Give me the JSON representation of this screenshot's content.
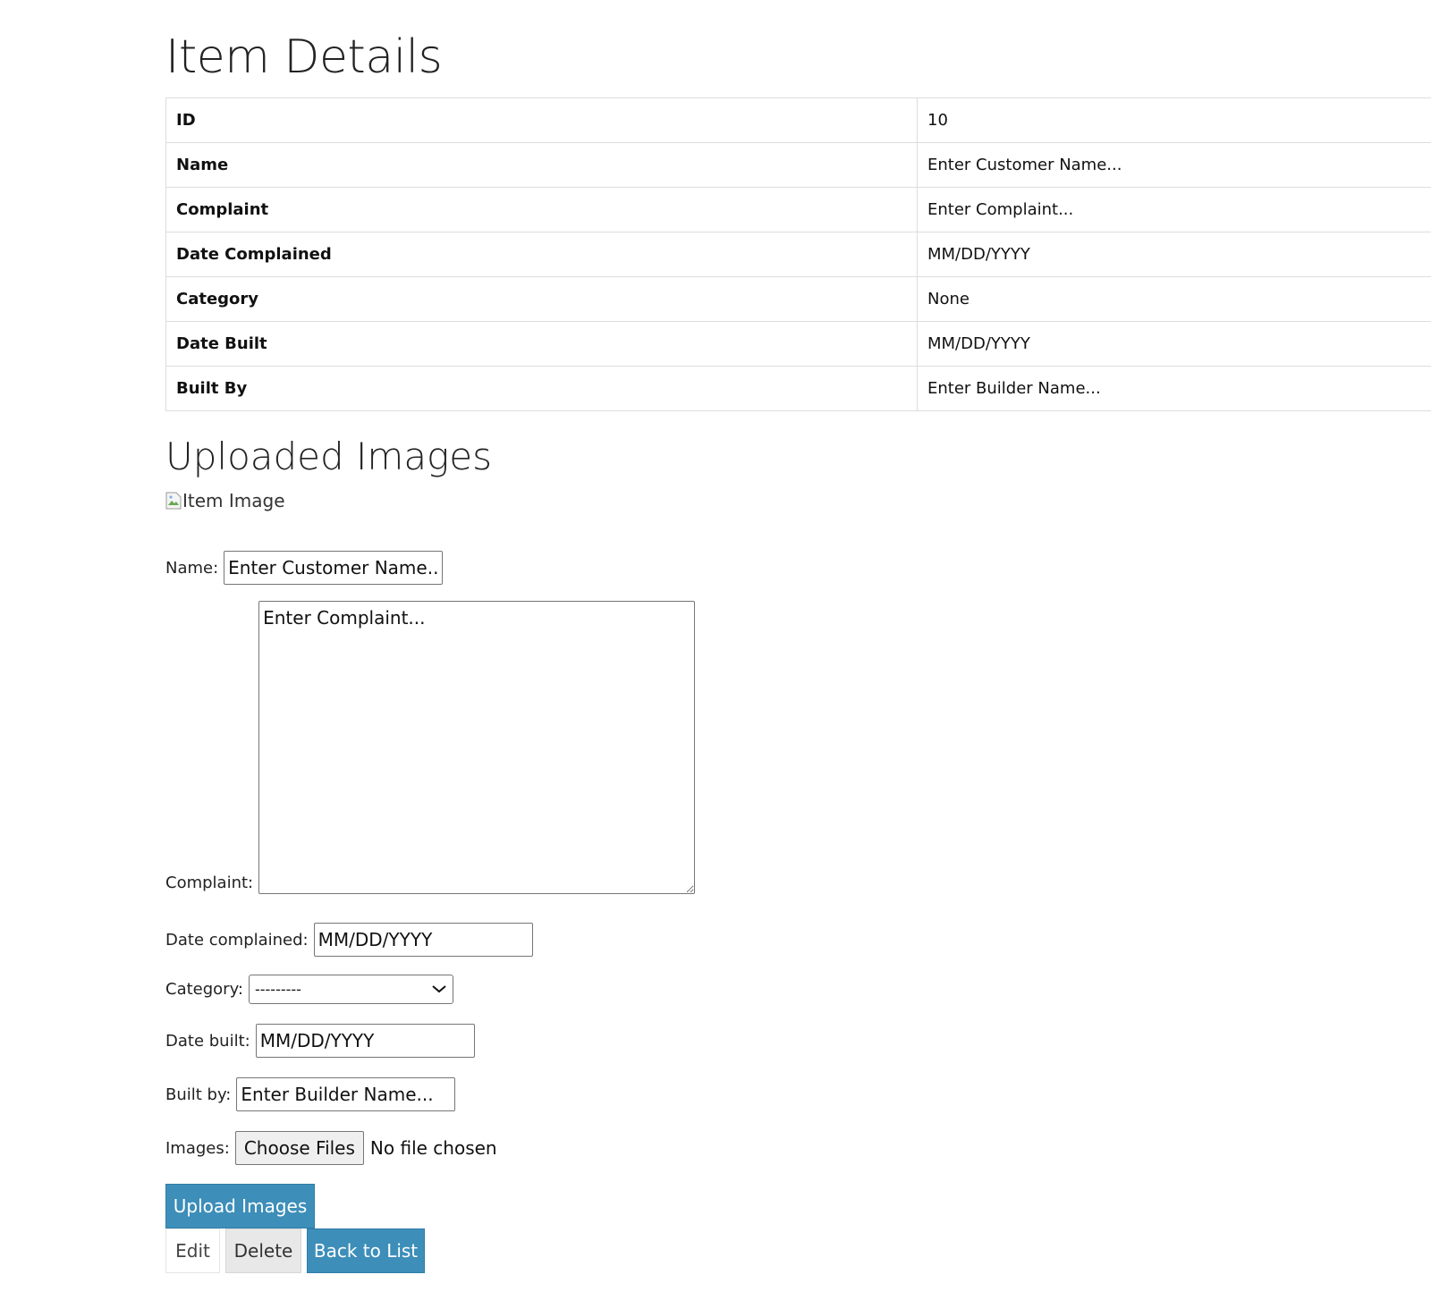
{
  "page": {
    "title": "Item Details",
    "uploaded_title": "Uploaded Images",
    "image_alt": "Item Image"
  },
  "details": [
    {
      "key": "ID",
      "value": "10"
    },
    {
      "key": "Name",
      "value": "Enter Customer Name..."
    },
    {
      "key": "Complaint",
      "value": "Enter Complaint..."
    },
    {
      "key": "Date Complained",
      "value": "MM/DD/YYYY"
    },
    {
      "key": "Category",
      "value": "None"
    },
    {
      "key": "Date Built",
      "value": "MM/DD/YYYY"
    },
    {
      "key": "Built By",
      "value": "Enter Builder Name..."
    }
  ],
  "form": {
    "name_label": "Name:",
    "name_placeholder": "Enter Customer Name...",
    "complaint_label": "Complaint:",
    "complaint_placeholder": "Enter Complaint...",
    "date_complained_label": "Date complained:",
    "date_complained_placeholder": "MM/DD/YYYY",
    "category_label": "Category:",
    "category_selected": "---------",
    "date_built_label": "Date built:",
    "date_built_placeholder": "MM/DD/YYYY",
    "built_by_label": "Built by:",
    "built_by_placeholder": "Enter Builder Name...",
    "images_label": "Images:",
    "choose_files_label": "Choose Files",
    "file_status": "No file chosen",
    "upload_button": "Upload Images"
  },
  "actions": {
    "edit": "Edit",
    "delete": "Delete",
    "back": "Back to List"
  },
  "colors": {
    "primary": "#3d8eb9",
    "table_border": "#dddddd"
  }
}
